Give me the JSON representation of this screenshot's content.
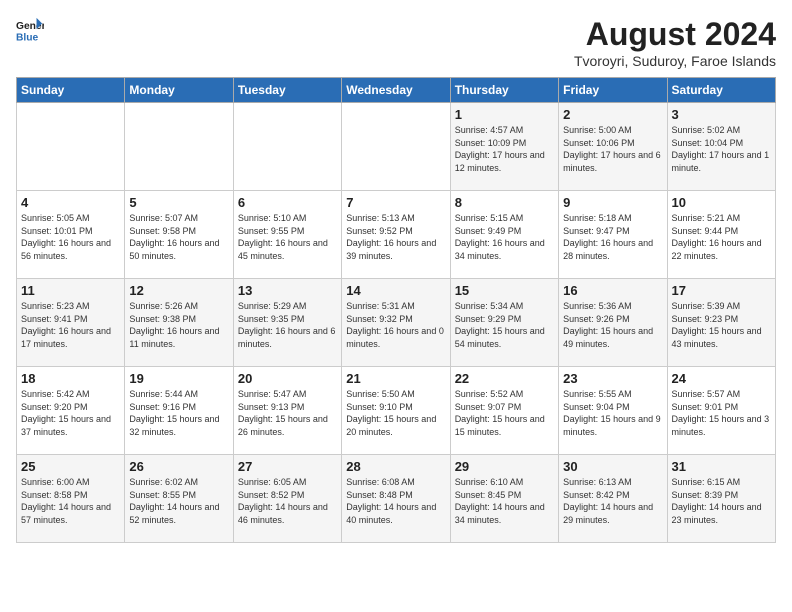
{
  "header": {
    "logo_line1": "General",
    "logo_line2": "Blue",
    "month_year": "August 2024",
    "location": "Tvoroyri, Suduroy, Faroe Islands"
  },
  "weekdays": [
    "Sunday",
    "Monday",
    "Tuesday",
    "Wednesday",
    "Thursday",
    "Friday",
    "Saturday"
  ],
  "weeks": [
    [
      {
        "day": "",
        "info": ""
      },
      {
        "day": "",
        "info": ""
      },
      {
        "day": "",
        "info": ""
      },
      {
        "day": "",
        "info": ""
      },
      {
        "day": "1",
        "info": "Sunrise: 4:57 AM\nSunset: 10:09 PM\nDaylight: 17 hours\nand 12 minutes."
      },
      {
        "day": "2",
        "info": "Sunrise: 5:00 AM\nSunset: 10:06 PM\nDaylight: 17 hours\nand 6 minutes."
      },
      {
        "day": "3",
        "info": "Sunrise: 5:02 AM\nSunset: 10:04 PM\nDaylight: 17 hours\nand 1 minute."
      }
    ],
    [
      {
        "day": "4",
        "info": "Sunrise: 5:05 AM\nSunset: 10:01 PM\nDaylight: 16 hours\nand 56 minutes."
      },
      {
        "day": "5",
        "info": "Sunrise: 5:07 AM\nSunset: 9:58 PM\nDaylight: 16 hours\nand 50 minutes."
      },
      {
        "day": "6",
        "info": "Sunrise: 5:10 AM\nSunset: 9:55 PM\nDaylight: 16 hours\nand 45 minutes."
      },
      {
        "day": "7",
        "info": "Sunrise: 5:13 AM\nSunset: 9:52 PM\nDaylight: 16 hours\nand 39 minutes."
      },
      {
        "day": "8",
        "info": "Sunrise: 5:15 AM\nSunset: 9:49 PM\nDaylight: 16 hours\nand 34 minutes."
      },
      {
        "day": "9",
        "info": "Sunrise: 5:18 AM\nSunset: 9:47 PM\nDaylight: 16 hours\nand 28 minutes."
      },
      {
        "day": "10",
        "info": "Sunrise: 5:21 AM\nSunset: 9:44 PM\nDaylight: 16 hours\nand 22 minutes."
      }
    ],
    [
      {
        "day": "11",
        "info": "Sunrise: 5:23 AM\nSunset: 9:41 PM\nDaylight: 16 hours\nand 17 minutes."
      },
      {
        "day": "12",
        "info": "Sunrise: 5:26 AM\nSunset: 9:38 PM\nDaylight: 16 hours\nand 11 minutes."
      },
      {
        "day": "13",
        "info": "Sunrise: 5:29 AM\nSunset: 9:35 PM\nDaylight: 16 hours\nand 6 minutes."
      },
      {
        "day": "14",
        "info": "Sunrise: 5:31 AM\nSunset: 9:32 PM\nDaylight: 16 hours\nand 0 minutes."
      },
      {
        "day": "15",
        "info": "Sunrise: 5:34 AM\nSunset: 9:29 PM\nDaylight: 15 hours\nand 54 minutes."
      },
      {
        "day": "16",
        "info": "Sunrise: 5:36 AM\nSunset: 9:26 PM\nDaylight: 15 hours\nand 49 minutes."
      },
      {
        "day": "17",
        "info": "Sunrise: 5:39 AM\nSunset: 9:23 PM\nDaylight: 15 hours\nand 43 minutes."
      }
    ],
    [
      {
        "day": "18",
        "info": "Sunrise: 5:42 AM\nSunset: 9:20 PM\nDaylight: 15 hours\nand 37 minutes."
      },
      {
        "day": "19",
        "info": "Sunrise: 5:44 AM\nSunset: 9:16 PM\nDaylight: 15 hours\nand 32 minutes."
      },
      {
        "day": "20",
        "info": "Sunrise: 5:47 AM\nSunset: 9:13 PM\nDaylight: 15 hours\nand 26 minutes."
      },
      {
        "day": "21",
        "info": "Sunrise: 5:50 AM\nSunset: 9:10 PM\nDaylight: 15 hours\nand 20 minutes."
      },
      {
        "day": "22",
        "info": "Sunrise: 5:52 AM\nSunset: 9:07 PM\nDaylight: 15 hours\nand 15 minutes."
      },
      {
        "day": "23",
        "info": "Sunrise: 5:55 AM\nSunset: 9:04 PM\nDaylight: 15 hours\nand 9 minutes."
      },
      {
        "day": "24",
        "info": "Sunrise: 5:57 AM\nSunset: 9:01 PM\nDaylight: 15 hours\nand 3 minutes."
      }
    ],
    [
      {
        "day": "25",
        "info": "Sunrise: 6:00 AM\nSunset: 8:58 PM\nDaylight: 14 hours\nand 57 minutes."
      },
      {
        "day": "26",
        "info": "Sunrise: 6:02 AM\nSunset: 8:55 PM\nDaylight: 14 hours\nand 52 minutes."
      },
      {
        "day": "27",
        "info": "Sunrise: 6:05 AM\nSunset: 8:52 PM\nDaylight: 14 hours\nand 46 minutes."
      },
      {
        "day": "28",
        "info": "Sunrise: 6:08 AM\nSunset: 8:48 PM\nDaylight: 14 hours\nand 40 minutes."
      },
      {
        "day": "29",
        "info": "Sunrise: 6:10 AM\nSunset: 8:45 PM\nDaylight: 14 hours\nand 34 minutes."
      },
      {
        "day": "30",
        "info": "Sunrise: 6:13 AM\nSunset: 8:42 PM\nDaylight: 14 hours\nand 29 minutes."
      },
      {
        "day": "31",
        "info": "Sunrise: 6:15 AM\nSunset: 8:39 PM\nDaylight: 14 hours\nand 23 minutes."
      }
    ]
  ]
}
